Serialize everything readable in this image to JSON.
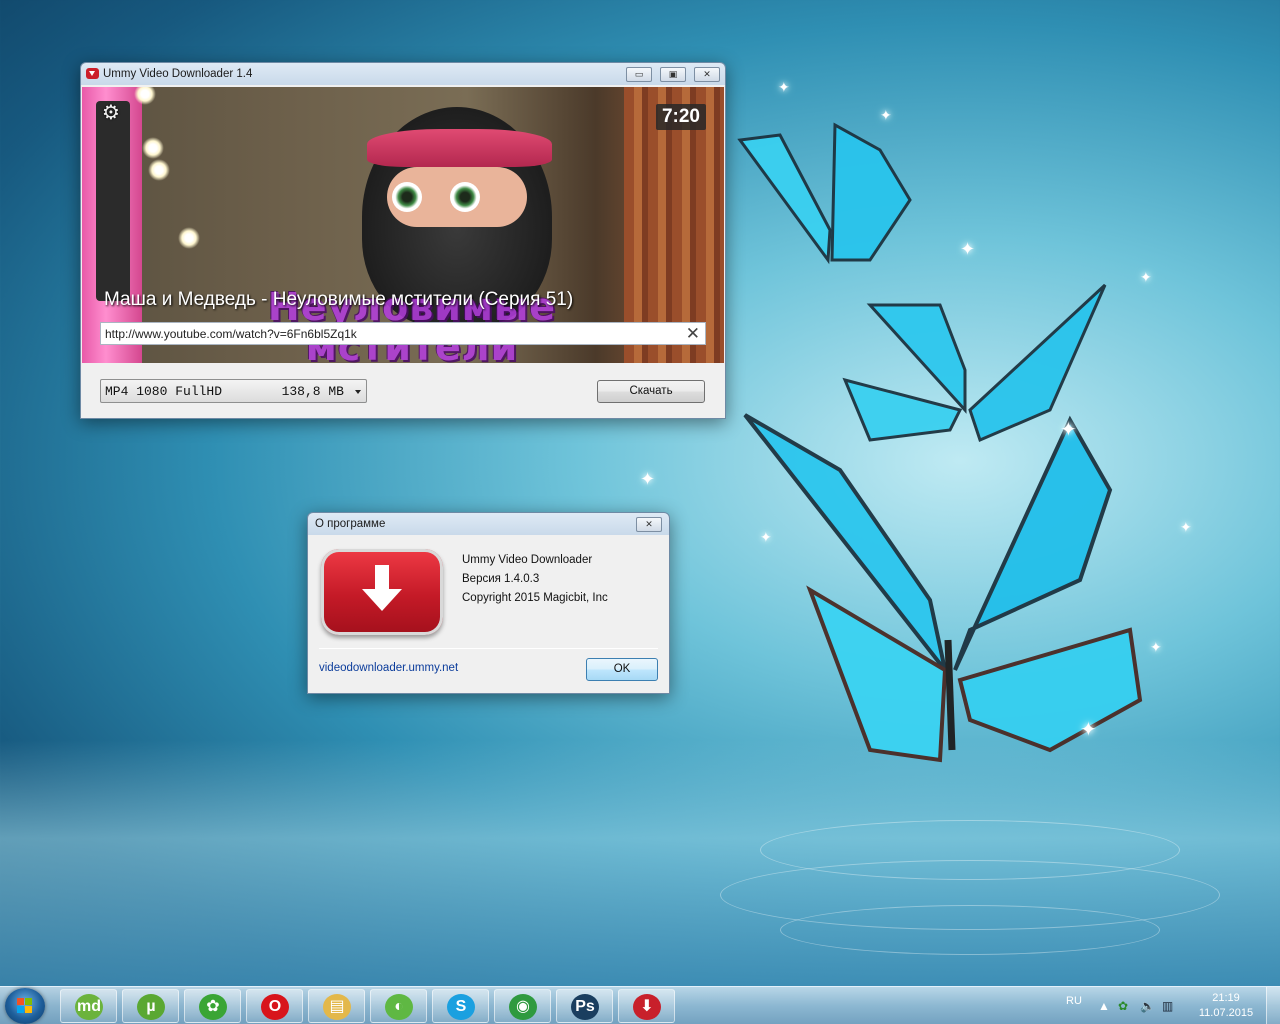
{
  "main_window": {
    "title": "Ummy Video Downloader 1.4",
    "controls": {
      "minimize": "▭",
      "maximize": "▣",
      "close": "✕"
    },
    "video": {
      "duration": "7:20",
      "title": "Маша и Медведь - Неуловимые мстители (Серия 51)",
      "overlay_text": "Неуловимые мстители"
    },
    "url": {
      "value": "http://www.youtube.com/watch?v=6Fn6bl5Zq1k",
      "clear": "✕"
    },
    "format": {
      "name": "MP4 1080 FullHD",
      "size": "138,8 MB"
    },
    "download_label": "Скачать"
  },
  "about_dialog": {
    "title": "О программе",
    "close": "✕",
    "app_name": "Ummy Video Downloader",
    "version": "Версия 1.4.0.3",
    "copyright": "Copyright 2015 Magicbit, Inc",
    "link": "videodownloader.ummy.net",
    "ok_label": "OK"
  },
  "taskbar": {
    "items": [
      {
        "name": "mydiary",
        "glyph": "md",
        "color": "#6bb33c"
      },
      {
        "name": "utorrent",
        "glyph": "µ",
        "color": "#5aa832"
      },
      {
        "name": "icq",
        "glyph": "✿",
        "color": "#3aa535"
      },
      {
        "name": "opera",
        "glyph": "O",
        "color": "#d8141b"
      },
      {
        "name": "explorer",
        "glyph": "▤",
        "color": "#e3b84a"
      },
      {
        "name": "browser",
        "glyph": "◐",
        "color": "#5fb843"
      },
      {
        "name": "skype",
        "glyph": "S",
        "color": "#1aa0e0"
      },
      {
        "name": "network",
        "glyph": "◉",
        "color": "#2f9a3f"
      },
      {
        "name": "photoshop",
        "glyph": "Ps",
        "color": "#1a3e5f"
      },
      {
        "name": "ummy",
        "glyph": "⬇",
        "color": "#c8202b"
      }
    ],
    "tray": {
      "language": "RU",
      "time": "21:19",
      "date": "11.07.2015"
    }
  }
}
